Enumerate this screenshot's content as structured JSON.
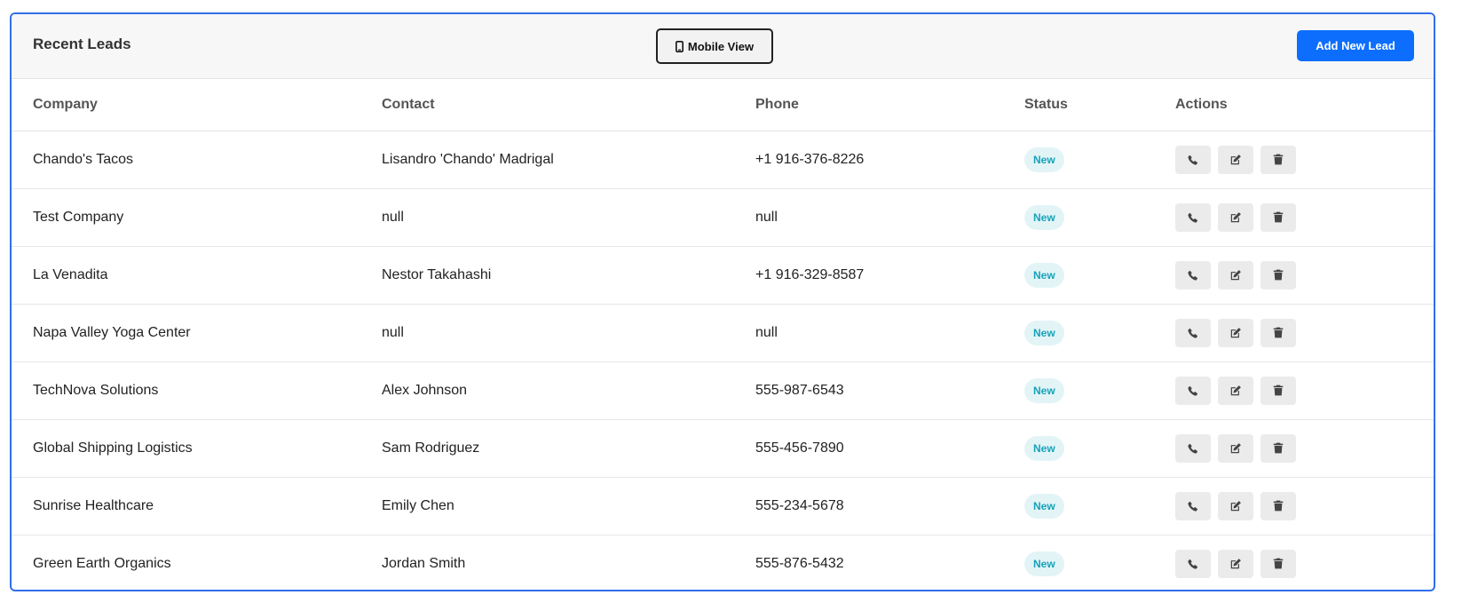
{
  "header": {
    "title": "Recent Leads",
    "mobile_view_label": "Mobile View",
    "add_lead_label": "Add New Lead"
  },
  "table": {
    "columns": [
      "Company",
      "Contact",
      "Phone",
      "Status",
      "Actions"
    ],
    "rows": [
      {
        "company": "Chando's Tacos",
        "contact": "Lisandro 'Chando' Madrigal",
        "phone": "+1 916-376-8226",
        "status": "New"
      },
      {
        "company": "Test Company",
        "contact": "null",
        "phone": "null",
        "status": "New"
      },
      {
        "company": "La Venadita",
        "contact": "Nestor Takahashi",
        "phone": "+1 916-329-8587",
        "status": "New"
      },
      {
        "company": "Napa Valley Yoga Center",
        "contact": "null",
        "phone": "null",
        "status": "New"
      },
      {
        "company": "TechNova Solutions",
        "contact": "Alex Johnson",
        "phone": "555-987-6543",
        "status": "New"
      },
      {
        "company": "Global Shipping Logistics",
        "contact": "Sam Rodriguez",
        "phone": "555-456-7890",
        "status": "New"
      },
      {
        "company": "Sunrise Healthcare",
        "contact": "Emily Chen",
        "phone": "555-234-5678",
        "status": "New"
      },
      {
        "company": "Green Earth Organics",
        "contact": "Jordan Smith",
        "phone": "555-876-5432",
        "status": "New"
      }
    ],
    "row_actions": [
      "phone-icon",
      "edit-icon",
      "trash-icon"
    ]
  },
  "colors": {
    "accent": "#0d6efd",
    "card_border": "#2f6fea",
    "badge_bg": "#e3f4f7",
    "badge_text": "#17a2b8"
  }
}
